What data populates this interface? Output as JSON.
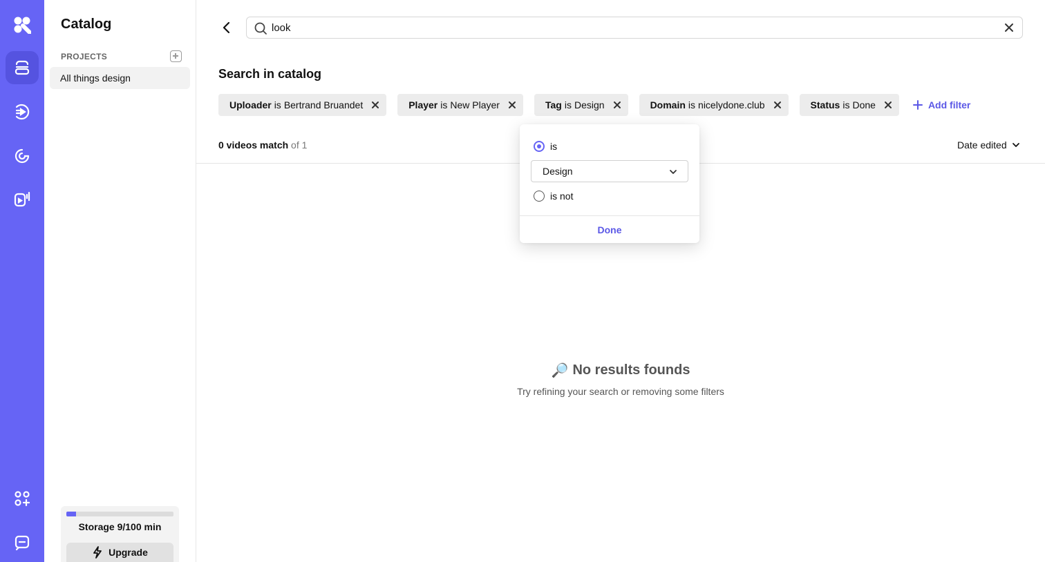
{
  "rail": {
    "items": [
      {
        "name": "logo",
        "active": false
      },
      {
        "name": "catalog-icon",
        "active": true
      },
      {
        "name": "broadcast-icon",
        "active": false
      },
      {
        "name": "analytics-icon",
        "active": false
      },
      {
        "name": "player-icon",
        "active": false
      },
      {
        "name": "apps-icon",
        "active": false
      },
      {
        "name": "chat-icon",
        "active": false
      }
    ],
    "accent": "#6664f5"
  },
  "sidebar": {
    "title": "Catalog",
    "section_label": "PROJECTS",
    "items": [
      {
        "label": "All things design",
        "selected": true
      }
    ],
    "storage": {
      "label": "Storage 9/100 min",
      "used": 9,
      "total": 100
    },
    "upgrade_label": "Upgrade"
  },
  "search": {
    "value": "look",
    "placeholder": ""
  },
  "main": {
    "heading": "Search in catalog",
    "filters": [
      {
        "field": "Uploader",
        "op": "is",
        "value": "Bertrand Bruandet"
      },
      {
        "field": "Player",
        "op": "is",
        "value": "New Player"
      },
      {
        "field": "Tag",
        "op": "is",
        "value": "Design"
      },
      {
        "field": "Domain",
        "op": "is",
        "value": "nicelydone.club"
      },
      {
        "field": "Status",
        "op": "is",
        "value": "Done"
      }
    ],
    "add_filter_label": "Add filter",
    "count_strong": "0 videos match",
    "count_muted": "of 1",
    "sort_label": "Date edited",
    "empty": {
      "icon": "🔎",
      "title": "No results founds",
      "subtitle": "Try refining your search or removing some filters"
    }
  },
  "popover": {
    "option_is": "is",
    "option_is_not": "is not",
    "selected_option": "is",
    "select_value": "Design",
    "done_label": "Done"
  }
}
